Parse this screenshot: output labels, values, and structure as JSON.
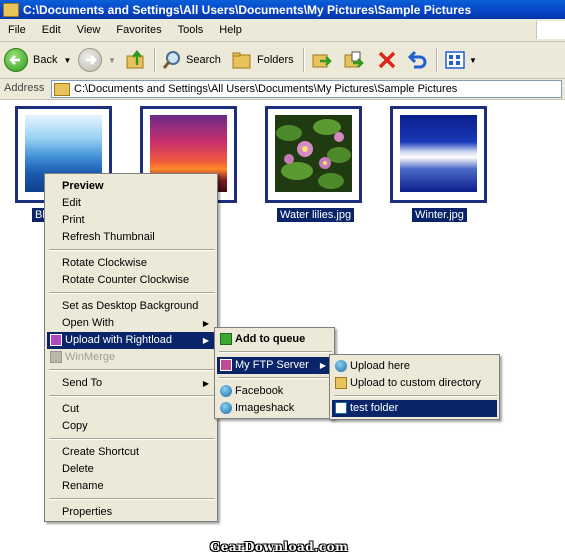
{
  "window": {
    "title": "C:\\Documents and Settings\\All Users\\Documents\\My Pictures\\Sample Pictures"
  },
  "menubar": [
    "File",
    "Edit",
    "View",
    "Favorites",
    "Tools",
    "Help"
  ],
  "toolbar": {
    "back_label": "Back",
    "search_label": "Search",
    "folders_label": "Folders"
  },
  "address": {
    "label": "Address",
    "value": "C:\\Documents and Settings\\All Users\\Documents\\My Pictures\\Sample Pictures"
  },
  "files": [
    {
      "name": "Bl",
      "icon": "blue-hills-image"
    },
    {
      "name": "",
      "icon": "sunset-image"
    },
    {
      "name": "Water lilies.jpg",
      "icon": "water-lilies-image"
    },
    {
      "name": "Winter.jpg",
      "icon": "winter-image"
    }
  ],
  "context_menu": {
    "preview": "Preview",
    "edit": "Edit",
    "print": "Print",
    "refresh_thumbnail": "Refresh Thumbnail",
    "rotate_cw": "Rotate Clockwise",
    "rotate_ccw": "Rotate Counter Clockwise",
    "set_desktop": "Set as Desktop Background",
    "open_with": "Open With",
    "upload_rightload": "Upload with Rightload",
    "winmerge": "WinMerge",
    "send_to": "Send To",
    "cut": "Cut",
    "copy": "Copy",
    "create_shortcut": "Create Shortcut",
    "delete": "Delete",
    "rename": "Rename",
    "properties": "Properties"
  },
  "rightload_menu": {
    "add_to_queue": "Add to queue",
    "my_ftp_server": "My FTP Server",
    "facebook": "Facebook",
    "imageshack": "Imageshack"
  },
  "ftp_menu": {
    "upload_here": "Upload here",
    "upload_custom": "Upload to custom directory",
    "test_folder": "test folder"
  },
  "watermark": "GearDownload.com",
  "colors": {
    "selection": "#0a246a",
    "menu_bg": "#ece9d8",
    "title_blue": "#0843c6"
  }
}
